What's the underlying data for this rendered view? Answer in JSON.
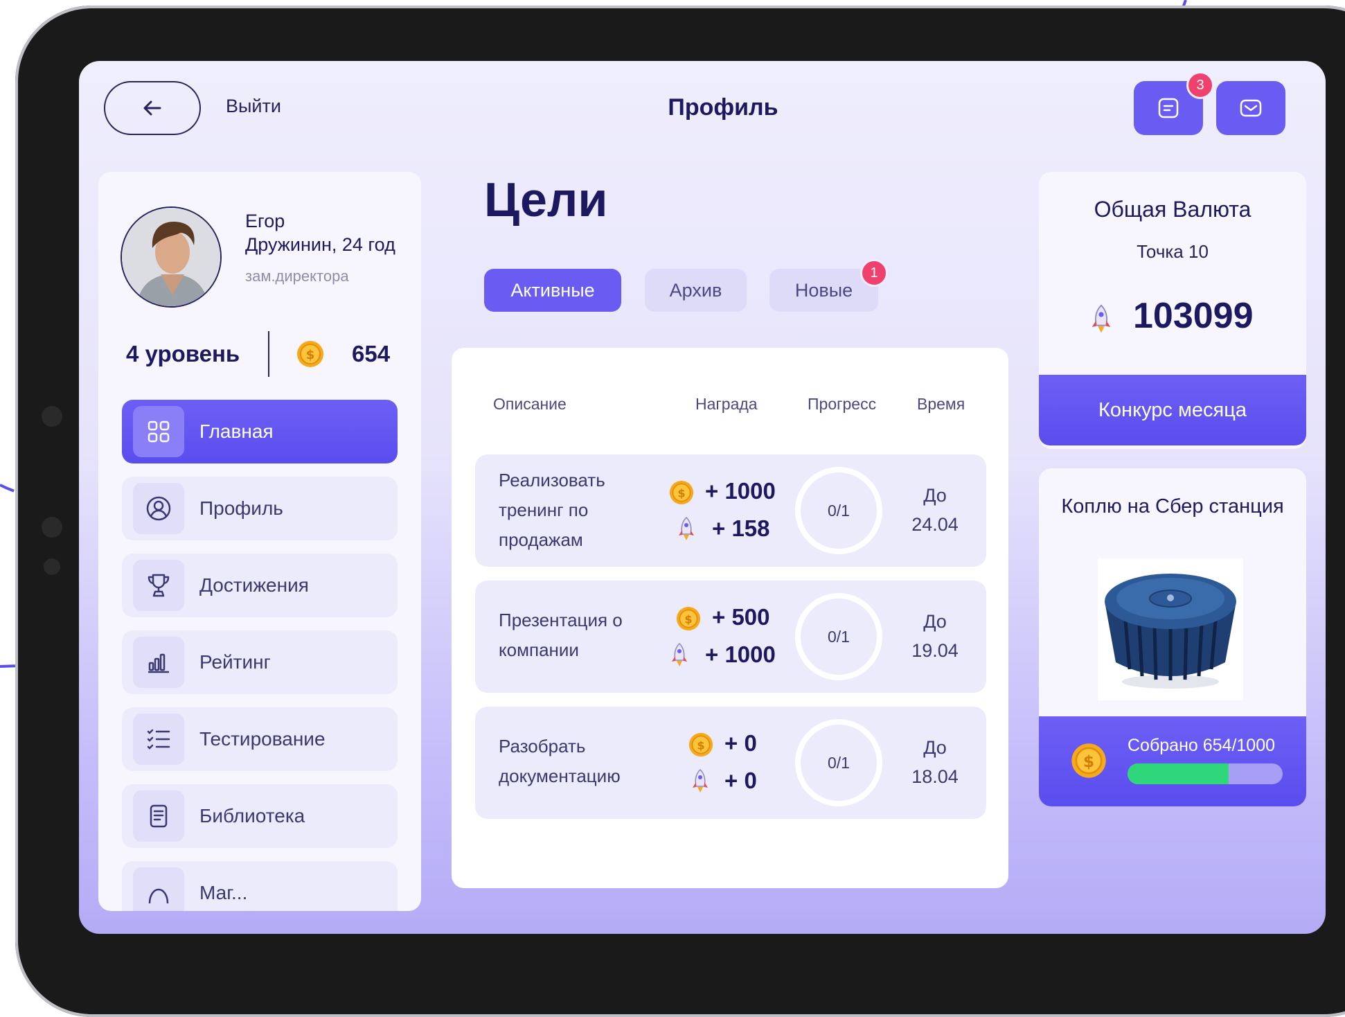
{
  "header": {
    "exit_label": "Выйти",
    "title": "Профиль",
    "notifications_count": "3",
    "back_icon": "arrow-left-icon",
    "chat_icon": "message-icon",
    "mail_icon": "mail-icon"
  },
  "user": {
    "first_name": "Егор",
    "last_name_age": "Дружинин, 24 год",
    "role": "зам.директора",
    "level": "4 уровень",
    "coins": "654"
  },
  "menu": [
    {
      "label": "Главная",
      "icon": "grid-icon",
      "active": true
    },
    {
      "label": "Профиль",
      "icon": "user-circle-icon",
      "active": false
    },
    {
      "label": "Достижения",
      "icon": "trophy-icon",
      "active": false
    },
    {
      "label": "Рейтинг",
      "icon": "bar-chart-icon",
      "active": false
    },
    {
      "label": "Тестирование",
      "icon": "checklist-icon",
      "active": false
    },
    {
      "label": "Библиотека",
      "icon": "document-icon",
      "active": false
    },
    {
      "label": "Маг...",
      "icon": "shop-icon",
      "active": false
    }
  ],
  "goals": {
    "title": "Цели",
    "tabs": [
      {
        "label": "Активные",
        "active": true
      },
      {
        "label": "Архив",
        "active": false
      },
      {
        "label": "Новые",
        "active": false,
        "badge": "1"
      }
    ],
    "columns": [
      "Описание",
      "Награда",
      "Прогресс",
      "Время"
    ],
    "rows": [
      {
        "description": "Реализовать тренинг по продажам",
        "coins_reward": "+ 1000",
        "rocket_reward": "+ 158",
        "progress": "0/1",
        "due_prefix": "До",
        "due_date": "24.04"
      },
      {
        "description": "Презентация о компании",
        "coins_reward": "+ 500",
        "rocket_reward": "+ 1000",
        "progress": "0/1",
        "due_prefix": "До",
        "due_date": "19.04"
      },
      {
        "description": "Разобрать документацию",
        "coins_reward": "+ 0",
        "rocket_reward": "+ 0",
        "progress": "0/1",
        "due_prefix": "До",
        "due_date": "18.04"
      }
    ]
  },
  "currency": {
    "title": "Общая Валюта",
    "subtitle": "Точка 10",
    "value": "103099",
    "contest_button": "Конкурс месяца"
  },
  "saving": {
    "title": "Коплю на Сбер станция",
    "collected_label": "Собрано 654/1000",
    "collected": 654,
    "target": 1000
  },
  "colors": {
    "accent": "#6a5cf2",
    "badge": "#f0416e",
    "progress": "#2fd67a",
    "text_dark": "#1c1960"
  }
}
